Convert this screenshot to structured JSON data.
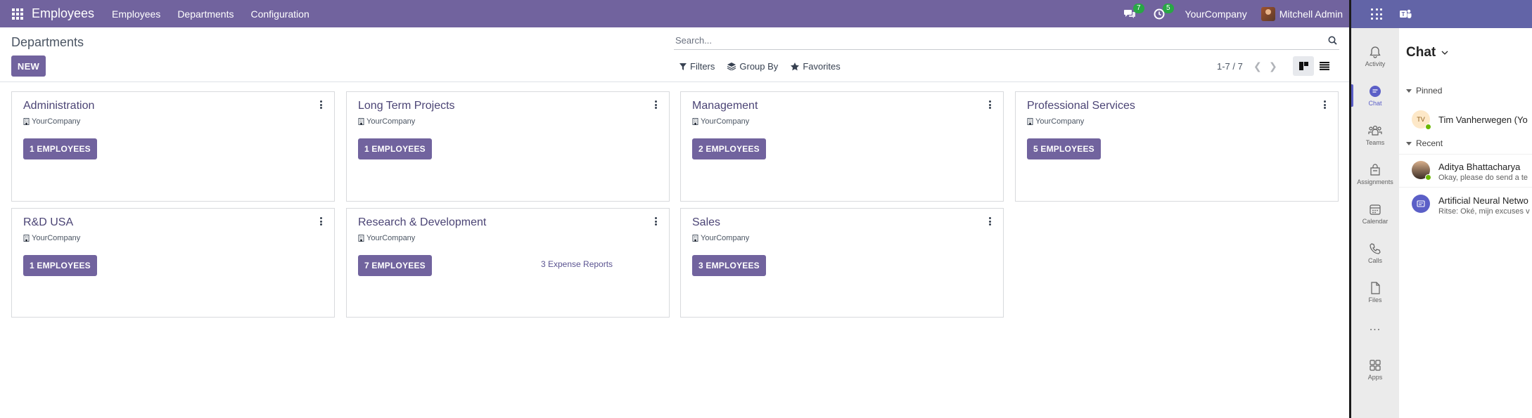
{
  "navbar": {
    "app_name": "Employees",
    "menu": [
      "Employees",
      "Departments",
      "Configuration"
    ],
    "messages_badge": "7",
    "activities_badge": "5",
    "company": "YourCompany",
    "user": "Mitchell Admin",
    "brand_color": "#71639e"
  },
  "control_panel": {
    "breadcrumb": "Departments",
    "new_label": "NEW",
    "search_placeholder": "Search...",
    "filters_label": "Filters",
    "groupby_label": "Group By",
    "favorites_label": "Favorites",
    "pager": "1-7 / 7"
  },
  "departments": [
    {
      "name": "Administration",
      "company": "YourCompany",
      "employees": "1 EMPLOYEES",
      "extra": ""
    },
    {
      "name": "Long Term Projects",
      "company": "YourCompany",
      "employees": "1 EMPLOYEES",
      "extra": ""
    },
    {
      "name": "Management",
      "company": "YourCompany",
      "employees": "2 EMPLOYEES",
      "extra": ""
    },
    {
      "name": "Professional Services",
      "company": "YourCompany",
      "employees": "5 EMPLOYEES",
      "extra": ""
    },
    {
      "name": "R&D USA",
      "company": "YourCompany",
      "employees": "1 EMPLOYEES",
      "extra": ""
    },
    {
      "name": "Research & Development",
      "company": "YourCompany",
      "employees": "7 EMPLOYEES",
      "extra": "3 Expense Reports"
    },
    {
      "name": "Sales",
      "company": "YourCompany",
      "employees": "3 EMPLOYEES",
      "extra": ""
    }
  ],
  "teams": {
    "accent_color": "#6264a7",
    "rail": [
      {
        "label": "Activity",
        "icon": "bell-icon"
      },
      {
        "label": "Chat",
        "icon": "chat-icon"
      },
      {
        "label": "Teams",
        "icon": "teams-icon"
      },
      {
        "label": "Assignments",
        "icon": "assignments-icon"
      },
      {
        "label": "Calendar",
        "icon": "calendar-icon"
      },
      {
        "label": "Calls",
        "icon": "phone-icon"
      },
      {
        "label": "Files",
        "icon": "file-icon"
      },
      {
        "label": "...",
        "icon": "more-icon"
      },
      {
        "label": "Apps",
        "icon": "apps-icon"
      }
    ],
    "chat_title": "Chat",
    "pinned_label": "Pinned",
    "recent_label": "Recent",
    "pinned": [
      {
        "initials": "TV",
        "name": "Tim Vanherwegen (Yo"
      }
    ],
    "recent": [
      {
        "name": "Aditya Bhattacharya",
        "preview": "Okay, please do send a te"
      },
      {
        "name": "Artificial Neural Netwo",
        "preview": "Ritse: Oké, mijn excuses v"
      }
    ]
  }
}
